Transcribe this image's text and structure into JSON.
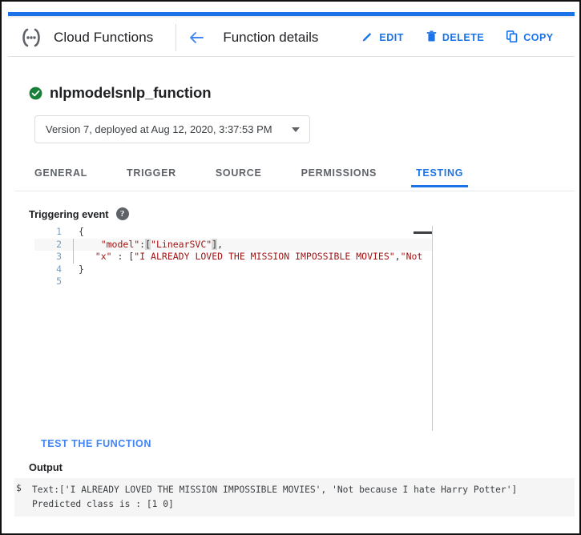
{
  "window": {
    "accent_blue": "#1a73e8",
    "border_color": "#111111"
  },
  "header": {
    "brand": "Cloud Functions",
    "brand_icon": "cloud-functions-icon",
    "back_icon": "back-arrow-icon",
    "page_title": "Function details",
    "actions": [
      {
        "label": "EDIT",
        "icon": "pencil-icon"
      },
      {
        "label": "DELETE",
        "icon": "trash-icon"
      },
      {
        "label": "COPY",
        "icon": "copy-icon"
      }
    ]
  },
  "function": {
    "status_icon": "check-circle-icon",
    "status_color": "#188038",
    "name": "nlpmodelsnlp_function",
    "version_select": {
      "value": "Version 7, deployed at Aug 12, 2020, 3:37:53 PM",
      "caret_icon": "chevron-down-icon"
    }
  },
  "tabs": [
    {
      "label": "GENERAL",
      "active": false
    },
    {
      "label": "TRIGGER",
      "active": false
    },
    {
      "label": "SOURCE",
      "active": false
    },
    {
      "label": "PERMISSIONS",
      "active": false
    },
    {
      "label": "TESTING",
      "active": true
    }
  ],
  "triggering_event": {
    "label": "Triggering event",
    "help_icon": "help-circle-icon",
    "help_glyph": "?",
    "editor": {
      "line_numbers": [
        "1",
        "2",
        "3",
        "4",
        "5"
      ],
      "lines": [
        {
          "n": "1",
          "text": "{"
        },
        {
          "n": "2",
          "text": "    \"model\":[\"LinearSVC\"],"
        },
        {
          "n": "3",
          "text": "   \"x\" : [\"I ALREADY LOVED THE MISSION IMPOSSIBLE MOVIES\",\"Not"
        },
        {
          "n": "4",
          "text": "}"
        },
        {
          "n": "5",
          "text": ""
        }
      ],
      "line2_parts": {
        "indent": "    ",
        "key": "\"model\"",
        "colon": ":",
        "open_bracket": "[",
        "value": "\"LinearSVC\"",
        "close_bracket": "]",
        "comma": ","
      },
      "line3_parts": {
        "indent": "   ",
        "key": "\"x\"",
        "colon": " : ",
        "open_bracket": "[",
        "value1": "\"I ALREADY LOVED THE MISSION IMPOSSIBLE MOVIES\"",
        "comma": ",",
        "value2_truncated": "\"Not"
      },
      "horizontal_scrollbar": "editor-horizontal-scrollbar"
    }
  },
  "actions": {
    "test_button": "TEST THE FUNCTION"
  },
  "output": {
    "label": "Output",
    "prompt": "$",
    "lines": [
      "Text:['I ALREADY LOVED THE MISSION IMPOSSIBLE MOVIES', 'Not because I hate Harry Potter']",
      "Predicted class is : [1 0]"
    ]
  }
}
